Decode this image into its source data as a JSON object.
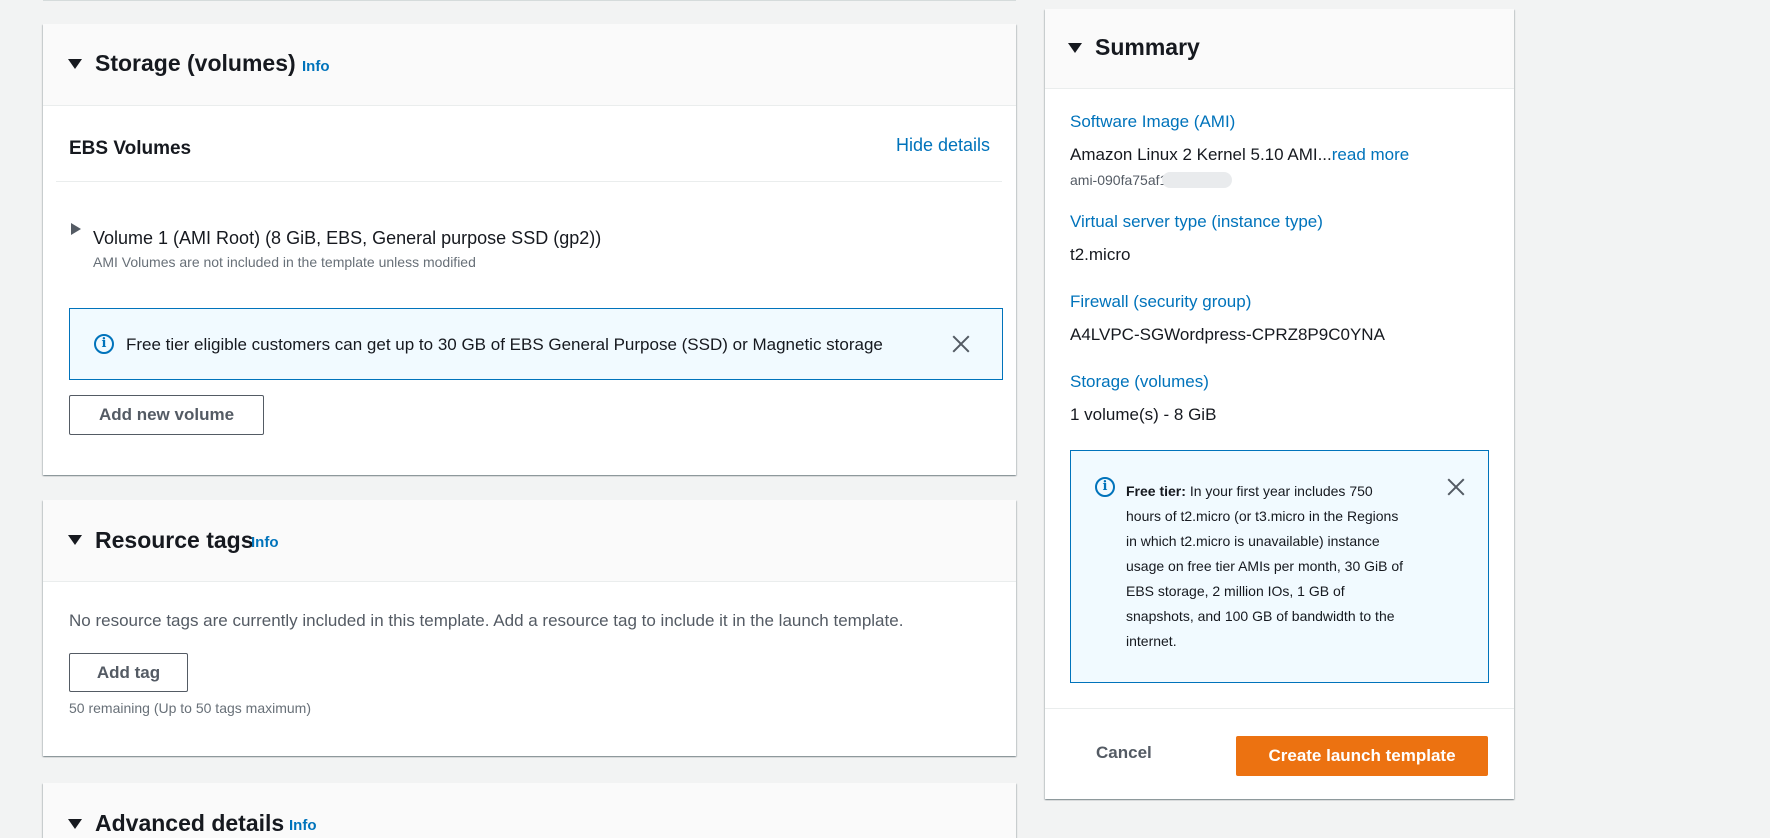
{
  "storage": {
    "title": "Storage (volumes)",
    "info": "Info",
    "ebs_title": "EBS Volumes",
    "hide_details": "Hide details",
    "volume_label": "Volume 1 (AMI Root) (8 GiB, EBS, General purpose SSD (gp2))",
    "volume_note": "AMI Volumes are not included in the template unless modified",
    "alert_text": "Free tier eligible customers can get up to 30 GB of EBS General Purpose (SSD) or Magnetic storage",
    "add_volume": "Add new volume"
  },
  "tags": {
    "title": "Resource tags",
    "info": "Info",
    "empty_text": "No resource tags are currently included in this template. Add a resource tag to include it in the launch template.",
    "add_tag": "Add tag",
    "remaining": "50 remaining (Up to 50 tags maximum)"
  },
  "advanced": {
    "title": "Advanced details",
    "info": "Info"
  },
  "summary": {
    "title": "Summary",
    "ami_label": "Software Image (AMI)",
    "ami_value": "Amazon Linux 2 Kernel 5.10 AMI...",
    "ami_read_more": "read more",
    "ami_id": "ami-090fa75af13c",
    "instance_label": "Virtual server type (instance type)",
    "instance_value": "t2.micro",
    "firewall_label": "Firewall (security group)",
    "firewall_value": "A4LVPC-SGWordpress-CPRZ8P9C0YNA",
    "storage_label": "Storage (volumes)",
    "storage_value": "1 volume(s) - 8 GiB",
    "free_tier_bold": "Free tier:",
    "free_tier_text": "In your first year includes 750 hours of t2.micro (or t3.micro in the Regions in which t2.micro is unavailable) instance usage on free tier AMIs per month, 30 GiB of EBS storage, 2 million IOs, 1 GB of snapshots, and 100 GB of bandwidth to the internet.",
    "cancel": "Cancel",
    "create": "Create launch template"
  },
  "colors": {
    "link": "#0073bb",
    "primary_button": "#ec7211",
    "background": "#f2f3f3"
  }
}
